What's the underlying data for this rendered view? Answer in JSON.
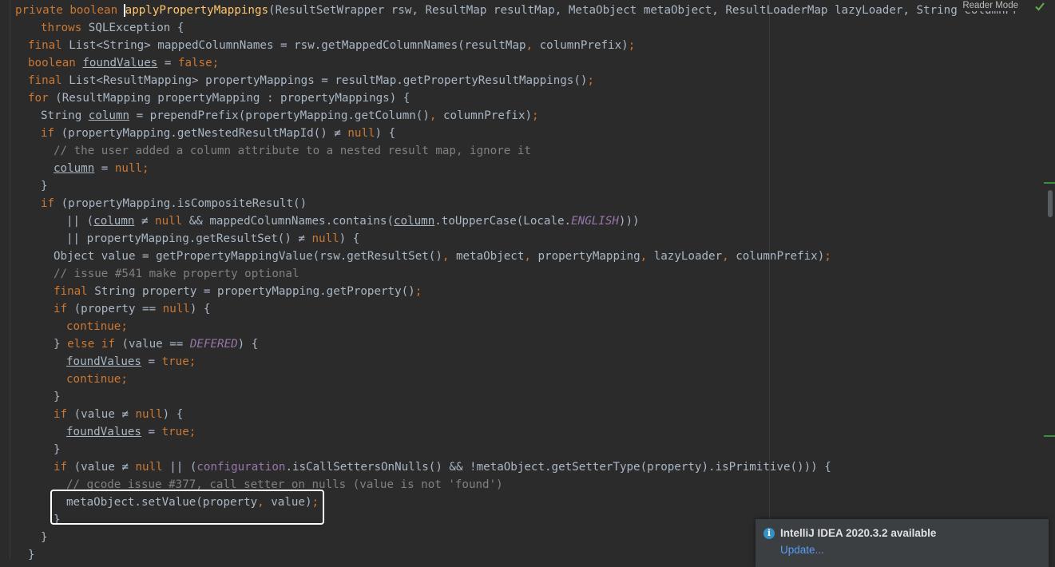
{
  "editor": {
    "reader_mode_label": "Reader Mode",
    "lines": [
      {
        "indent": 0,
        "tokens": [
          [
            "private boolean ",
            "k"
          ],
          [
            "",
            "caret"
          ],
          [
            "applyPropertyMappings",
            "m"
          ],
          [
            "(ResultSetWrapper rsw, ResultMap resultMap, MetaObject metaObject, ResultLoaderMap lazyLoader, String columnPr",
            ""
          ]
        ]
      },
      {
        "indent": 3,
        "tokens": [
          [
            "throws ",
            "k"
          ],
          [
            "SQLException {",
            ""
          ]
        ]
      },
      {
        "indent": 2,
        "tokens": [
          [
            "final ",
            "k"
          ],
          [
            "List<String> mappedColumnNames = rsw.getMappedColumnNames(resultMap",
            ""
          ],
          [
            ", ",
            "k"
          ],
          [
            "columnPrefix)",
            ""
          ],
          [
            ";",
            "k"
          ]
        ]
      },
      {
        "indent": 2,
        "tokens": [
          [
            "boolean ",
            "k"
          ],
          [
            "foundValues",
            "u"
          ],
          [
            " = ",
            ""
          ],
          [
            "false",
            "k"
          ],
          [
            ";",
            "k"
          ]
        ]
      },
      {
        "indent": 2,
        "tokens": [
          [
            "final ",
            "k"
          ],
          [
            "List<ResultMapping> propertyMappings = resultMap.getPropertyResultMappings()",
            ""
          ],
          [
            ";",
            "k"
          ]
        ]
      },
      {
        "indent": 2,
        "tokens": [
          [
            "for ",
            "k"
          ],
          [
            "(ResultMapping propertyMapping : propertyMappings) {",
            ""
          ]
        ]
      },
      {
        "indent": 3,
        "tokens": [
          [
            "String ",
            ""
          ],
          [
            "column",
            "u"
          ],
          [
            " = prependPrefix(propertyMapping.getColumn()",
            ""
          ],
          [
            ", ",
            "k"
          ],
          [
            "columnPrefix)",
            ""
          ],
          [
            ";",
            "k"
          ]
        ]
      },
      {
        "indent": 3,
        "tokens": [
          [
            "if ",
            "k"
          ],
          [
            "(propertyMapping.getNestedResultMapId() ≠ ",
            ""
          ],
          [
            "null",
            "k"
          ],
          [
            ") {",
            ""
          ]
        ]
      },
      {
        "indent": 4,
        "tokens": [
          [
            "// the user added a column attribute to a nested result map, ignore it",
            "c"
          ]
        ]
      },
      {
        "indent": 4,
        "tokens": [
          [
            "column",
            "u"
          ],
          [
            " = ",
            ""
          ],
          [
            "null",
            "k"
          ],
          [
            ";",
            "k"
          ]
        ]
      },
      {
        "indent": 3,
        "tokens": [
          [
            "}",
            ""
          ]
        ]
      },
      {
        "indent": 3,
        "tokens": [
          [
            "if ",
            "k"
          ],
          [
            "(propertyMapping.isCompositeResult()",
            ""
          ]
        ]
      },
      {
        "indent": 5,
        "tokens": [
          [
            "|| (",
            ""
          ],
          [
            "column",
            "u"
          ],
          [
            " ≠ ",
            ""
          ],
          [
            "null ",
            "k"
          ],
          [
            "&& mappedColumnNames.contains(",
            ""
          ],
          [
            "column",
            "u"
          ],
          [
            ".toUpperCase(Locale.",
            ""
          ],
          [
            "ENGLISH",
            "fi"
          ],
          [
            ")))",
            ""
          ]
        ]
      },
      {
        "indent": 5,
        "tokens": [
          [
            "|| propertyMapping.getResultSet() ≠ ",
            ""
          ],
          [
            "null",
            "k"
          ],
          [
            ") {",
            ""
          ]
        ]
      },
      {
        "indent": 4,
        "tokens": [
          [
            "Object value = getPropertyMappingValue(rsw.getResultSet()",
            ""
          ],
          [
            ", ",
            "k"
          ],
          [
            "metaObject",
            ""
          ],
          [
            ", ",
            "k"
          ],
          [
            "propertyMapping",
            ""
          ],
          [
            ", ",
            "k"
          ],
          [
            "lazyLoader",
            ""
          ],
          [
            ", ",
            "k"
          ],
          [
            "columnPrefix)",
            ""
          ],
          [
            ";",
            "k"
          ]
        ]
      },
      {
        "indent": 4,
        "tokens": [
          [
            "// issue #541 make property optional",
            "c"
          ]
        ]
      },
      {
        "indent": 4,
        "tokens": [
          [
            "final ",
            "k"
          ],
          [
            "String property = propertyMapping.getProperty()",
            ""
          ],
          [
            ";",
            "k"
          ]
        ]
      },
      {
        "indent": 4,
        "tokens": [
          [
            "if ",
            "k"
          ],
          [
            "(property == ",
            ""
          ],
          [
            "null",
            "k"
          ],
          [
            ") {",
            ""
          ]
        ]
      },
      {
        "indent": 5,
        "tokens": [
          [
            "continue",
            "k"
          ],
          [
            ";",
            "k"
          ]
        ]
      },
      {
        "indent": 4,
        "tokens": [
          [
            "} ",
            ""
          ],
          [
            "else if ",
            "k"
          ],
          [
            "(value == ",
            ""
          ],
          [
            "DEFERED",
            "fi"
          ],
          [
            ") {",
            ""
          ]
        ]
      },
      {
        "indent": 5,
        "tokens": [
          [
            "foundValues",
            "u"
          ],
          [
            " = ",
            ""
          ],
          [
            "true",
            "k"
          ],
          [
            ";",
            "k"
          ]
        ]
      },
      {
        "indent": 5,
        "tokens": [
          [
            "continue",
            "k"
          ],
          [
            ";",
            "k"
          ]
        ]
      },
      {
        "indent": 4,
        "tokens": [
          [
            "}",
            ""
          ]
        ]
      },
      {
        "indent": 4,
        "tokens": [
          [
            "if ",
            "k"
          ],
          [
            "(value ≠ ",
            ""
          ],
          [
            "null",
            "k"
          ],
          [
            ") {",
            ""
          ]
        ]
      },
      {
        "indent": 5,
        "tokens": [
          [
            "foundValues",
            "u"
          ],
          [
            " = ",
            ""
          ],
          [
            "true",
            "k"
          ],
          [
            ";",
            "k"
          ]
        ]
      },
      {
        "indent": 4,
        "tokens": [
          [
            "}",
            ""
          ]
        ]
      },
      {
        "indent": 4,
        "tokens": [
          [
            "if ",
            "k"
          ],
          [
            "(value ≠ ",
            ""
          ],
          [
            "null ",
            "k"
          ],
          [
            "|| (",
            ""
          ],
          [
            "configuration",
            "f"
          ],
          [
            ".isCallSettersOnNulls() && !metaObject.getSetterType(property).isPrimitive())) {",
            ""
          ]
        ]
      },
      {
        "indent": 5,
        "tokens": [
          [
            "// gcode issue #377, call setter on nulls (value is not 'found')",
            "c"
          ]
        ]
      },
      {
        "indent": 5,
        "tokens": [
          [
            "metaObject.setValue(property",
            ""
          ],
          [
            ", ",
            "k"
          ],
          [
            "value)",
            ""
          ],
          [
            ";",
            "k"
          ]
        ]
      },
      {
        "indent": 4,
        "tokens": [
          [
            "}",
            ""
          ]
        ]
      },
      {
        "indent": 3,
        "tokens": [
          [
            "}",
            ""
          ]
        ]
      },
      {
        "indent": 2,
        "tokens": [
          [
            "}",
            ""
          ]
        ]
      }
    ]
  },
  "notification": {
    "title": "IntelliJ IDEA 2020.3.2 available",
    "link": "Update..."
  },
  "colors": {
    "background": "#2b2b2b",
    "keyword": "#cc7832",
    "method": "#ffc66d",
    "field": "#9876aa",
    "comment": "#808080",
    "text": "#a9b7c6",
    "link": "#589df6",
    "info": "#3592c4"
  },
  "icons": {
    "check": "check-icon",
    "info": "info-icon"
  }
}
